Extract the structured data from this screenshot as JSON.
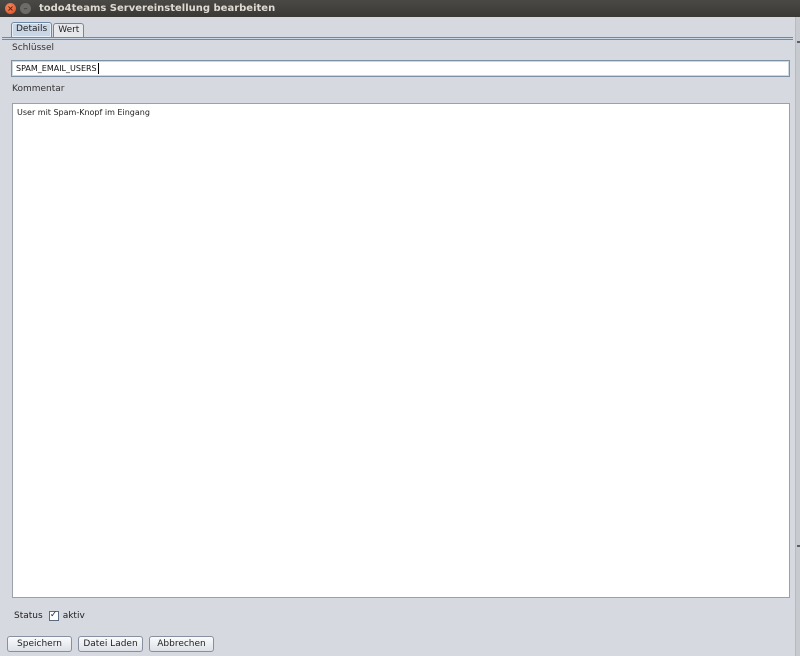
{
  "window": {
    "title": "todo4teams Servereinstellung bearbeiten",
    "close_glyph": "×",
    "minimize_glyph": "–"
  },
  "tabs": [
    {
      "label": "Details",
      "active": true
    },
    {
      "label": "Wert",
      "active": false
    }
  ],
  "form": {
    "key_label": "Schlüssel",
    "key_value": "SPAM_EMAIL_USERS",
    "comment_label": "Kommentar",
    "comment_value": "User mit Spam-Knopf im Eingang",
    "status_label": "Status",
    "active_checked": true,
    "active_label": "aktiv",
    "check_glyph": "✓"
  },
  "buttons": {
    "save": "Speichern",
    "load_file": "Datei Laden",
    "cancel": "Abbrechen"
  },
  "colors": {
    "accent": "#6e89a8",
    "active_tab": "#c9d6e6",
    "titlebar": "#3a3936",
    "close_button": "#e0481c"
  }
}
